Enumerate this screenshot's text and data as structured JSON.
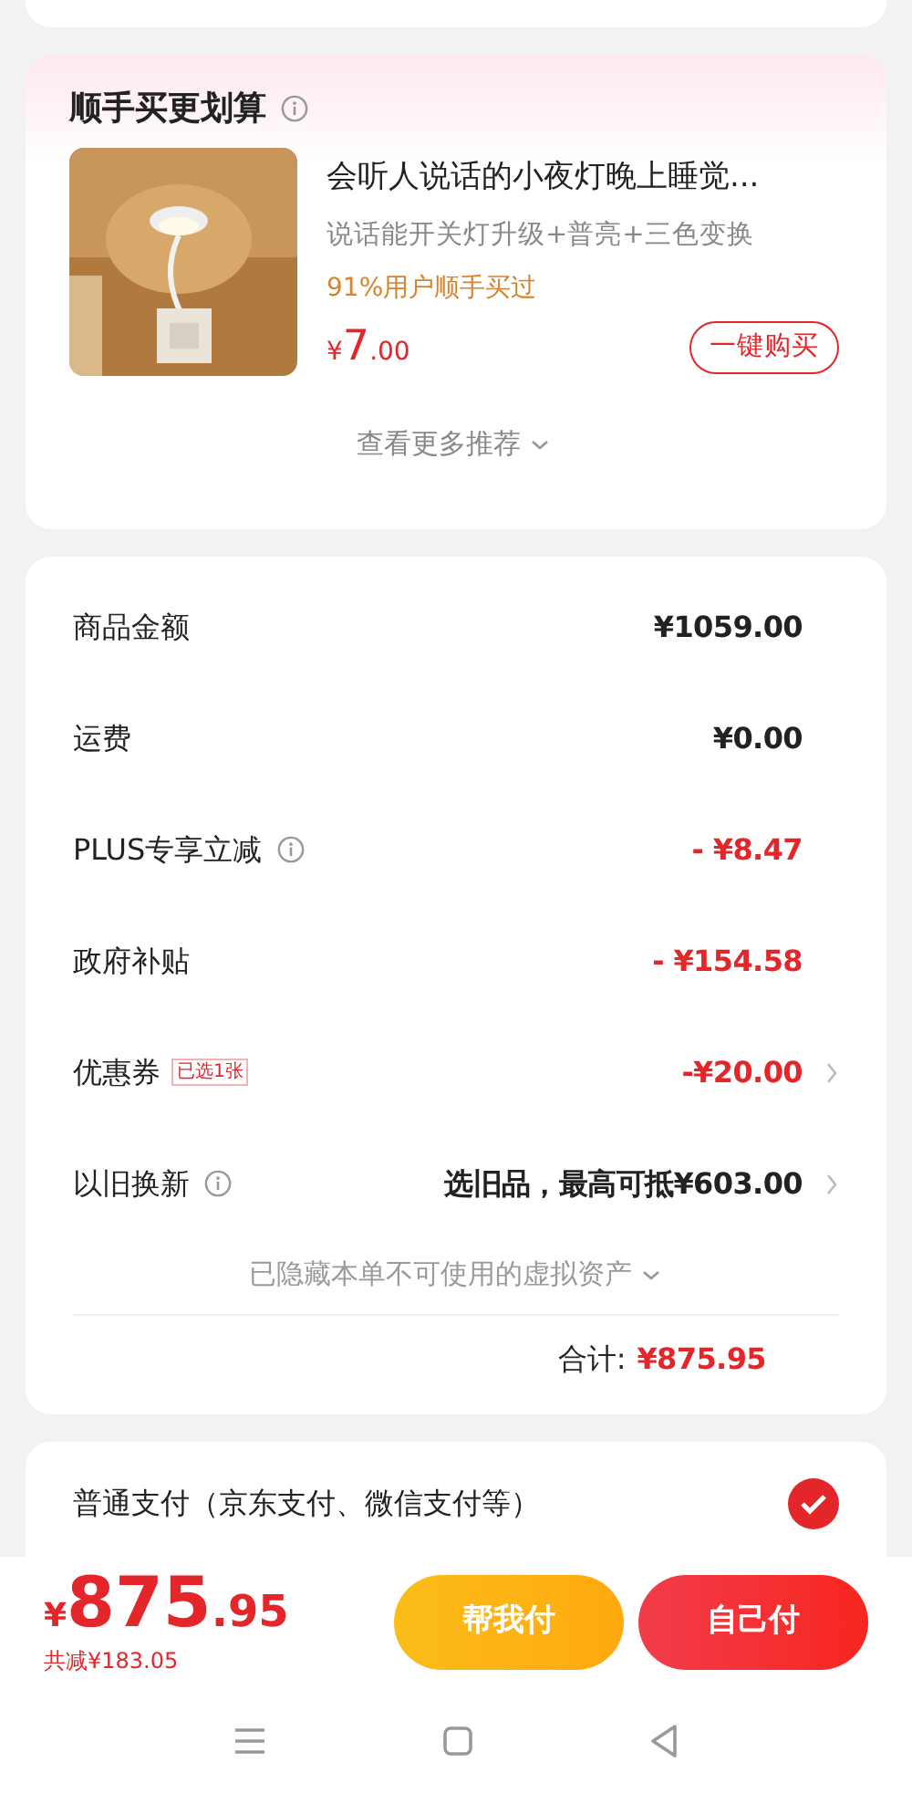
{
  "recommend": {
    "title": "顺手买更划算",
    "product": {
      "kind": "picture",
      "name": "会听人说话的小夜灯晚上睡觉...",
      "subtitle": "说话能开关灯升级+普亮+三色变换",
      "social": "91%用户顺手买过",
      "price": {
        "currency": "¥",
        "integer": "7",
        "decimal": ".00"
      },
      "buy_button": "一键购买"
    },
    "more": "查看更多推荐"
  },
  "fees": {
    "rows": [
      {
        "label": "商品金额",
        "value": "¥1059.00",
        "red": false,
        "info": false,
        "arrow": false
      },
      {
        "label": "运费",
        "value": "¥0.00",
        "red": false,
        "info": false,
        "arrow": false
      },
      {
        "label": "PLUS专享立减",
        "value": "- ¥8.47",
        "red": true,
        "info": true,
        "arrow": false
      },
      {
        "label": "政府补贴",
        "value": "- ¥154.58",
        "red": true,
        "info": false,
        "arrow": false
      },
      {
        "label": "优惠券",
        "tag": "已选1张",
        "value": "-¥20.00",
        "red": true,
        "info": false,
        "arrow": true
      },
      {
        "label": "以旧换新",
        "value": "选旧品，最高可抵¥603.00",
        "red": false,
        "info": true,
        "arrow": true
      }
    ],
    "hidden_note": "已隐藏本单不可使用的虚拟资产",
    "total_label": "合计:",
    "total_value": "¥875.95"
  },
  "payment": {
    "option": "普通支付（京东支付、微信支付等）",
    "checked": true
  },
  "bottom_bar": {
    "price": {
      "currency": "¥",
      "integer": "875",
      "decimal": ".95"
    },
    "saved": "共减¥183.05",
    "buttons": [
      {
        "label": "帮我付",
        "kind": "secondary"
      },
      {
        "label": "自己付",
        "kind": "primary"
      }
    ]
  }
}
